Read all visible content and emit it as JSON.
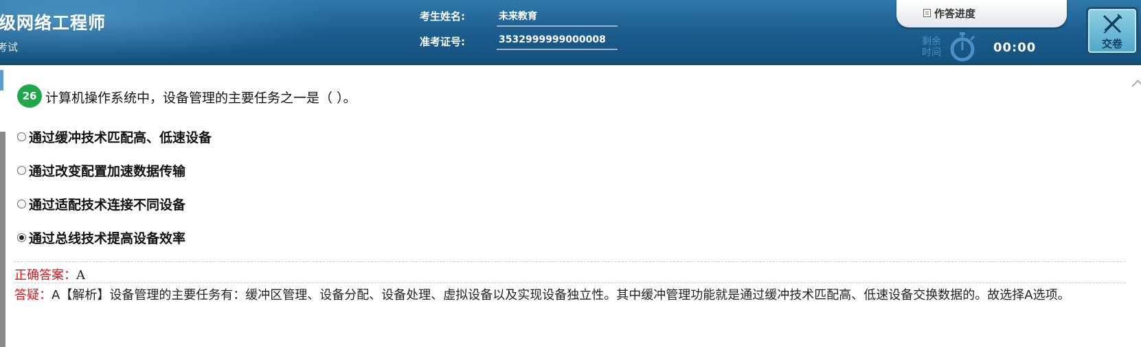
{
  "header": {
    "exam_title": "级网络工程师",
    "exam_subtitle": "考试",
    "candidate_name_label": "考生姓名:",
    "candidate_name": "未来教育",
    "candidate_id_label": "准考证号:",
    "candidate_id": "3532999999000008",
    "progress_label": "作答进度",
    "remaining_time_label": "剩余时间",
    "remaining_time": "00:00",
    "submit_label": "交卷"
  },
  "question": {
    "number": "26",
    "text": "计算机操作系统中，设备管理的主要任务之一是（ ）。",
    "options": [
      {
        "text": "通过缓冲技术匹配高、低速设备",
        "selected": false
      },
      {
        "text": "通过改变配置加速数据传输",
        "selected": false
      },
      {
        "text": "通过适配技术连接不同设备",
        "selected": false
      },
      {
        "text": "通过总线技术提高设备效率",
        "selected": true
      }
    ]
  },
  "answer": {
    "label": "正确答案：",
    "value": "A"
  },
  "explanation": {
    "label": "答疑：",
    "text": "A【解析】设备管理的主要任务有：缓冲区管理、设备分配、设备处理、虚拟设备以及实现设备独立性。其中缓冲管理功能就是通过缓冲技术匹配高、低速设备交换数据的。故选择A选项。"
  },
  "colors": {
    "header_blue": "#1c5f8f",
    "question_badge": "#1fa849",
    "answer_red": "#e01010",
    "timer_icon": "#4c8fc4"
  }
}
